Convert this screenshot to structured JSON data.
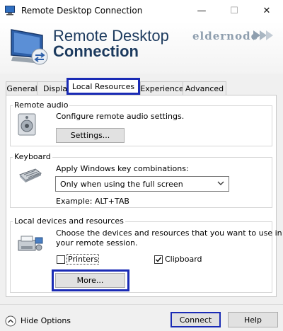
{
  "window": {
    "title": "Remote Desktop Connection",
    "minimize_glyph": "—",
    "maximize_glyph": "☐",
    "close_glyph": "✕"
  },
  "banner": {
    "line1": "Remote Desktop",
    "line2": "Connection",
    "logo_text": "eldernode"
  },
  "tabs": [
    {
      "label": "General"
    },
    {
      "label": "Display"
    },
    {
      "label": "Local Resources"
    },
    {
      "label": "Experience"
    },
    {
      "label": "Advanced"
    }
  ],
  "remote_audio": {
    "title": "Remote audio",
    "description": "Configure remote audio settings.",
    "settings_label": "Settings..."
  },
  "keyboard": {
    "title": "Keyboard",
    "apply_label": "Apply Windows key combinations:",
    "selected_option": "Only when using the full screen",
    "example": "Example: ALT+TAB"
  },
  "local_devices": {
    "title": "Local devices and resources",
    "description_line1": "Choose the devices and resources that you want to use in",
    "description_line2": "your remote session.",
    "printers_label": "Printers",
    "printers_checked": false,
    "clipboard_label": "Clipboard",
    "clipboard_checked": true,
    "more_label": "More..."
  },
  "footer": {
    "hide_options_label": "Hide Options",
    "connect_label": "Connect",
    "help_label": "Help"
  },
  "colors": {
    "highlight": "#1a2bb5",
    "brand_text": "#1c3a5e"
  }
}
